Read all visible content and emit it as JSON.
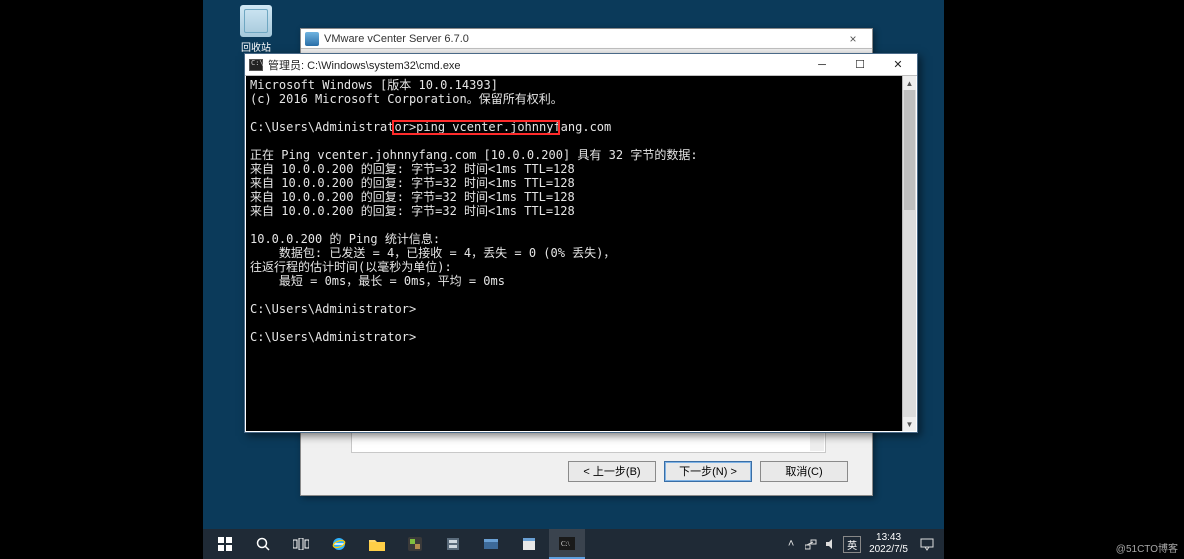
{
  "desktop": {
    "recycle_label": "回收站"
  },
  "vcenter": {
    "title": "VMware vCenter Server 6.7.0",
    "buttons": {
      "back": "< 上一步(B)",
      "next": "下一步(N) >",
      "cancel": "取消(C)"
    }
  },
  "cmd": {
    "title": "管理员: C:\\Windows\\system32\\cmd.exe",
    "prompt1_prefix": "C:\\Users\\Administrator>",
    "prompt1_command": "ping vcenter.johnnyfang.com",
    "lines": {
      "l0": "Microsoft Windows [版本 10.0.14393]",
      "l1": "(c) 2016 Microsoft Corporation。保留所有权利。",
      "l2": "",
      "l3a": "C:\\Users\\Administrator>",
      "l3b": "ping vcenter.johnnyfang.com",
      "l4": "",
      "l5": "正在 Ping vcenter.johnnyfang.com [10.0.0.200] 具有 32 字节的数据:",
      "l6": "来自 10.0.0.200 的回复: 字节=32 时间<1ms TTL=128",
      "l7": "来自 10.0.0.200 的回复: 字节=32 时间<1ms TTL=128",
      "l8": "来自 10.0.0.200 的回复: 字节=32 时间<1ms TTL=128",
      "l9": "来自 10.0.0.200 的回复: 字节=32 时间<1ms TTL=128",
      "l10": "",
      "l11": "10.0.0.200 的 Ping 统计信息:",
      "l12": "    数据包: 已发送 = 4，已接收 = 4，丢失 = 0 (0% 丢失)，",
      "l13": "往返行程的估计时间(以毫秒为单位):",
      "l14": "    最短 = 0ms，最长 = 0ms，平均 = 0ms",
      "l15": "",
      "l16": "C:\\Users\\Administrator>",
      "l17": "",
      "l18": "C:\\Users\\Administrator>"
    }
  },
  "taskbar": {
    "ime": "英",
    "time": "13:43",
    "date": "2022/7/5"
  },
  "watermark": "@51CTO博客"
}
